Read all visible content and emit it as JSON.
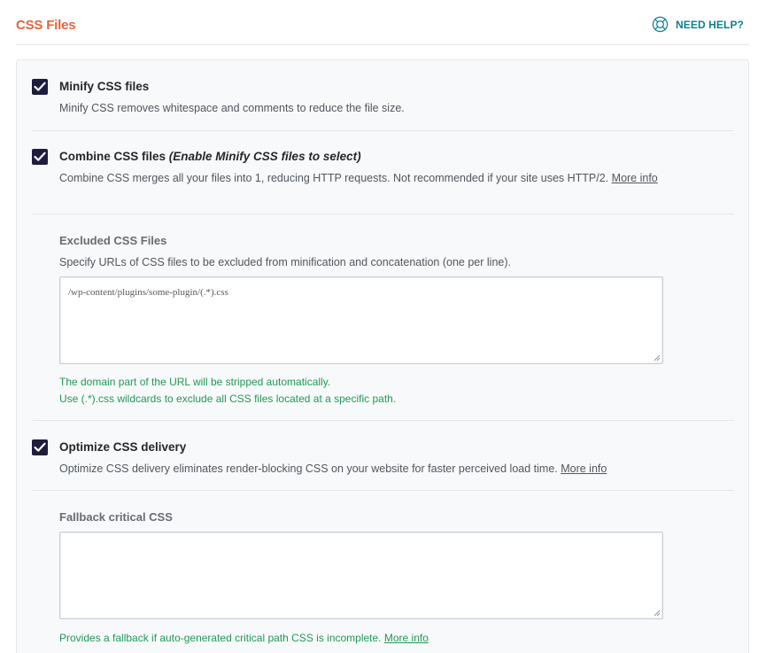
{
  "header": {
    "title": "CSS Files",
    "help_label": "NEED HELP?",
    "help_icon": "lifebuoy-icon"
  },
  "colors": {
    "title": "#e5633f",
    "help": "#0e7e8e",
    "checkbox": "#1f1d3d",
    "hint": "#1f9a55"
  },
  "options": {
    "minify": {
      "title": "Minify CSS files",
      "checked": true,
      "description": "Minify CSS removes whitespace and comments to reduce the file size."
    },
    "combine": {
      "title": "Combine CSS files",
      "title_note": "(Enable Minify CSS files to select)",
      "checked": true,
      "description": "Combine CSS merges all your files into 1, reducing HTTP requests. Not recommended if your site uses HTTP/2.",
      "link": "More info"
    },
    "excluded": {
      "title": "Excluded CSS Files",
      "description": "Specify URLs of CSS files to be excluded from minification and concatenation (one per line).",
      "value": "/wp-content/plugins/some-plugin/(.*).css",
      "hint_1": "The domain part of the URL will be stripped automatically.",
      "hint_2": "Use (.*).css wildcards to exclude all CSS files located at a specific path."
    },
    "optimize": {
      "title": "Optimize CSS delivery",
      "checked": true,
      "description": "Optimize CSS delivery eliminates render-blocking CSS on your website for faster perceived load time.",
      "link": "More info"
    },
    "fallback": {
      "title": "Fallback critical CSS",
      "value": "",
      "hint": "Provides a fallback if auto-generated critical path CSS is incomplete.",
      "link": "More info"
    }
  }
}
